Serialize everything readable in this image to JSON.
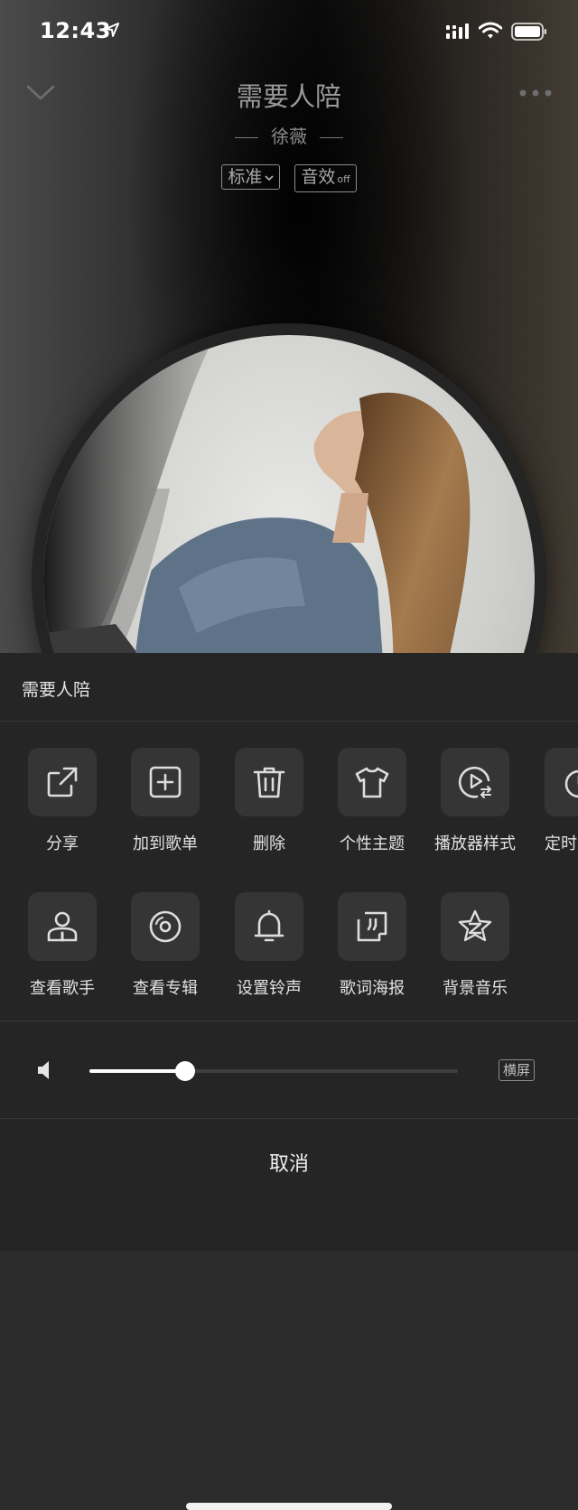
{
  "status_bar": {
    "time": "12:43"
  },
  "player": {
    "song_title": "需要人陪",
    "artist": "徐薇",
    "quality_chip": "标准",
    "effect_chip": "音效",
    "effect_state": "off"
  },
  "sheet": {
    "title": "需要人陪",
    "actions_row1": [
      {
        "label": "分享",
        "icon": "share-icon"
      },
      {
        "label": "加到歌单",
        "icon": "add-to-playlist-icon"
      },
      {
        "label": "删除",
        "icon": "trash-icon"
      },
      {
        "label": "个性主题",
        "icon": "tshirt-icon"
      },
      {
        "label": "播放器样式",
        "icon": "player-style-icon"
      },
      {
        "label": "定时",
        "icon": "timer-icon"
      }
    ],
    "actions_row2": [
      {
        "label": "查看歌手",
        "icon": "singer-icon"
      },
      {
        "label": "查看专辑",
        "icon": "album-icon"
      },
      {
        "label": "设置铃声",
        "icon": "bell-icon"
      },
      {
        "label": "歌词海报",
        "icon": "lyrics-poster-icon"
      },
      {
        "label": "背景音乐",
        "icon": "background-music-icon"
      }
    ],
    "volume_level": 0.26,
    "landscape_label": "横屏",
    "cancel_label": "取消"
  }
}
